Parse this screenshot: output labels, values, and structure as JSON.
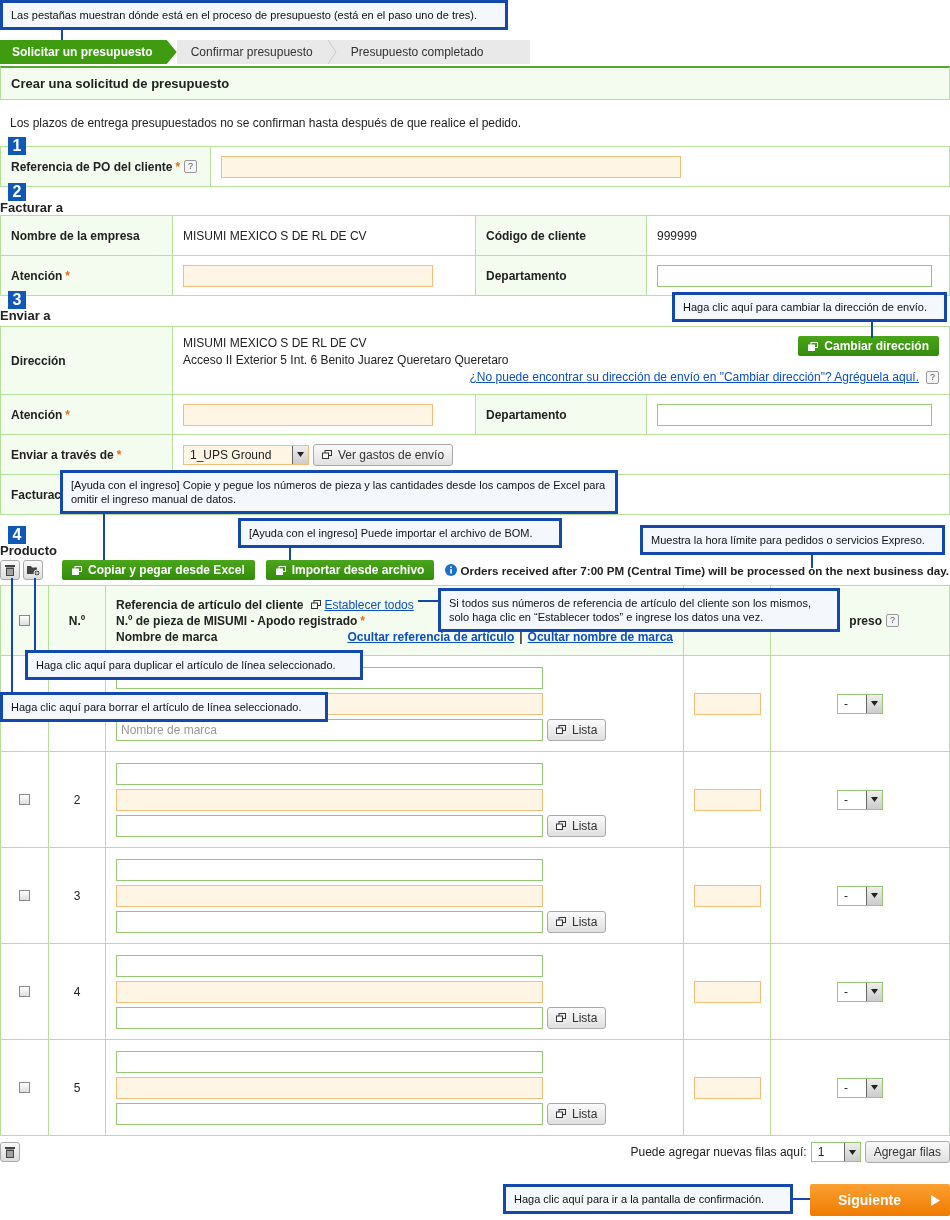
{
  "callouts": [
    {
      "text": "Las pestañas muestran dónde está en el proceso de presupuesto (está en el paso uno de tres)."
    },
    {
      "text": "Haga clic aquí para cambiar la dirección de envío."
    },
    {
      "text": "[Ayuda con el ingreso] Copie y pegue los números de pieza y las cantidades desde los campos de Excel para omitir el ingreso manual de datos."
    },
    {
      "text": "[Ayuda con el ingreso] Puede importar el archivo de BOM."
    },
    {
      "text": "Muestra la hora límite para pedidos o servicios Expreso."
    },
    {
      "text": "Si todos sus números de referencia de artículo del cliente son los mismos, solo haga clic en “Establecer todos” e ingrese los datos una vez."
    },
    {
      "text": "Haga clic aquí para duplicar el artículo de línea seleccionado."
    },
    {
      "text": "Haga clic aquí para borrar el artículo de línea seleccionado."
    },
    {
      "text": "Haga clic aquí para ir a la pantalla de confirmación."
    }
  ],
  "steps": [
    {
      "label": "Solicitar un presupuesto",
      "selected": true
    },
    {
      "label": "Confirmar presupuesto",
      "selected": false
    },
    {
      "label": "Presupuesto completado",
      "selected": false
    }
  ],
  "page_title": "Crear una solicitud de presupuesto",
  "notice": "Los plazos de entrega presupuestados no se confirman hasta después de que realice el pedido.",
  "po_section": {
    "marker": "1",
    "label": "Referencia de PO del cliente",
    "required_mark": "*",
    "help_mark": "?"
  },
  "bill_to": {
    "marker": "2",
    "heading": "Facturar a",
    "company_label": "Nombre de la empresa",
    "company": "MISUMI MEXICO S DE RL DE CV",
    "customer_code_label": "Código de cliente",
    "customer_code": "999999",
    "attention_label": "Atención",
    "attention_required_mark": "*",
    "department_label": "Departamento"
  },
  "ship_to": {
    "marker": "3",
    "heading": "Enviar a",
    "address_label": "Dirección",
    "address_lines": [
      "MISUMI MEXICO S DE RL DE CV",
      "Acceso II Exterior 5 Int. 6 Benito Juarez Queretaro Queretaro"
    ],
    "change_button": "Cambiar dirección",
    "add_link": "¿No puede encontrar su dirección de envío en \"Cambiar dirección\"? Agréguela aquí.",
    "add_link_help_mark": "?",
    "attention_label": "Atención",
    "attention_required_mark": "*",
    "department_label": "Departamento",
    "ship_via_label": "Enviar a través de",
    "ship_via_required_mark": "*",
    "ship_via": "1_UPS Ground",
    "shipping_cost_button": "Ver gastos de envío",
    "billing_label": "Facturac"
  },
  "products": {
    "marker": "4",
    "heading": "Producto",
    "excel_button": "Copiar y pegar desde Excel",
    "import_button": "Importar desde archivo",
    "cutoff_notice": "Orders received after 7:00 PM (Central Time) will be processed on the next business day.",
    "header": {
      "checked": false,
      "number": "N.º",
      "customer_ref": "Referencia de artículo del cliente",
      "set_all_link": "Establecer todos",
      "part_number": "N.º de pieza de MISUMI - Apodo registrado",
      "part_required_mark": "*",
      "brand": "Nombre de marca",
      "hide_ref_link": "Ocultar referencia de artículo",
      "separator": "|",
      "hide_brand_link": "Ocultar nombre de marca",
      "express": "preso",
      "express_help_mark": "?"
    },
    "rows": [
      {
        "brand_placeholder": "Nombre de marca",
        "list_button": "Lista",
        "express_value": "-"
      },
      {
        "checked": false,
        "number": "2",
        "list_button": "Lista",
        "express_value": "-"
      },
      {
        "checked": false,
        "number": "3",
        "list_button": "Lista",
        "express_value": "-"
      },
      {
        "checked": false,
        "number": "4",
        "list_button": "Lista",
        "express_value": "-"
      },
      {
        "checked": false,
        "number": "5",
        "list_button": "Lista",
        "express_value": "-"
      }
    ]
  },
  "footer": {
    "add_rows_label": "Puede agregar nuevas filas aquí:",
    "row_count": "1",
    "add_rows_button": "Agregar filas",
    "next_button": "Siguiente"
  }
}
